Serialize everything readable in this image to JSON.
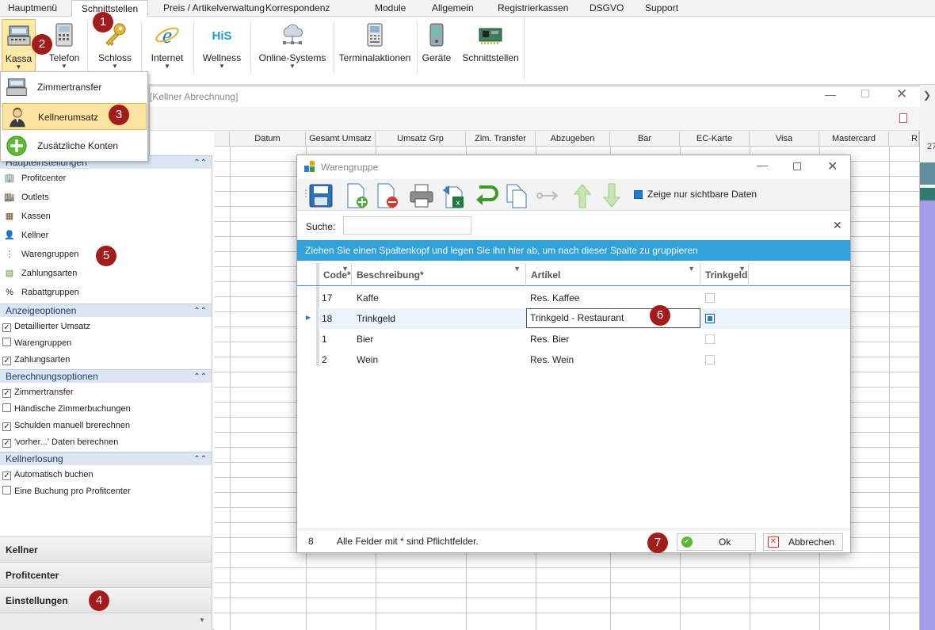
{
  "menu": {
    "tabs": [
      "Hauptmenü",
      "Schnittstellen",
      "Preis / Artikelverwaltung",
      "Korrespondenz",
      "Module",
      "Allgemein",
      "Registrierkassen",
      "DSGVO",
      "Support"
    ]
  },
  "ribbon": {
    "buttons": [
      {
        "label": "Kassa",
        "icon": "cash-register-icon"
      },
      {
        "label": "Telefon",
        "icon": "phone-icon"
      },
      {
        "label": "Schloss",
        "icon": "key-icon"
      },
      {
        "label": "Internet",
        "icon": "internet-explorer-icon"
      },
      {
        "label": "Wellness",
        "icon": "his-logo-icon"
      },
      {
        "label": "Online-Systems",
        "icon": "cloud-network-icon"
      },
      {
        "label": "Terminalaktionen",
        "icon": "terminal-icon"
      },
      {
        "label": "Geräte",
        "icon": "device-icon"
      },
      {
        "label": "Schnittstellen",
        "icon": "circuit-board-icon"
      }
    ]
  },
  "dropdown": {
    "items": [
      {
        "label": "Zimmertransfer",
        "icon": "cash-register-icon"
      },
      {
        "label": "Kellnerumsatz",
        "icon": "waiter-icon"
      },
      {
        "label": "Zusätzliche Konten",
        "icon": "add-icon"
      }
    ]
  },
  "backwindow": {
    "title": "[Kellner Abrechnung]",
    "columns": [
      "Datum",
      "Gesamt Umsatz",
      "Umsatz Grp",
      "Zim. Transfer",
      "Abzugeben",
      "Bar",
      "EC-Karte",
      "Visa",
      "Mastercard",
      "R"
    ],
    "right_edge_value": "27"
  },
  "leftpanel": {
    "groups": {
      "haupt": "Haupteinstellungen",
      "anzeige": "Anzeigeoptionen",
      "berechnung": "Berechnungsoptionen",
      "kellnerlosung": "Kellnerlosung"
    },
    "haupt_items": [
      "Profitcenter",
      "Outlets",
      "Kassen",
      "Kellner",
      "Warengruppen",
      "Zahlungsarten",
      "Rabattgruppen"
    ],
    "anzeige_items": [
      {
        "label": "Detaillierter Umsatz",
        "checked": true
      },
      {
        "label": "Warengruppen",
        "checked": false
      },
      {
        "label": "Zahlungsarten",
        "checked": true
      }
    ],
    "berechnung_items": [
      {
        "label": "Zimmertransfer",
        "checked": true
      },
      {
        "label": "Händische Zimmerbuchungen",
        "checked": false
      },
      {
        "label": "Schulden manuell brerechnen",
        "checked": true
      },
      {
        "label": "'vorher...' Daten berechnen",
        "checked": true
      }
    ],
    "kellner_items": [
      {
        "label": "Automatisch buchen",
        "checked": true
      },
      {
        "label": "Eine Buchung pro Profitcenter",
        "checked": false
      }
    ],
    "nav": [
      "Kellner",
      "Profitcenter",
      "Einstellungen"
    ]
  },
  "dialog": {
    "title": "Warengruppe",
    "visible_only_label": "Zeige nur sichtbare Daten",
    "search_label": "Suche:",
    "search_value": "",
    "group_hint": "Ziehen Sie einen Spaltenkopf und legen Sie ihn hier ab, um nach dieser Spalte zu gruppieren",
    "columns": [
      "Code*",
      "Beschreibung*",
      "Artikel",
      "Trinkgeld"
    ],
    "rows": [
      {
        "code": "17",
        "beschreibung": "Kaffe",
        "artikel": "Res. Kaffee",
        "trinkgeld": false
      },
      {
        "code": "18",
        "beschreibung": "Trinkgeld",
        "artikel": "Trinkgeld - Restaurant",
        "trinkgeld": true
      },
      {
        "code": "1",
        "beschreibung": "Bier",
        "artikel": "Res. Bier",
        "trinkgeld": false
      },
      {
        "code": "2",
        "beschreibung": "Wein",
        "artikel": "Res. Wein",
        "trinkgeld": false
      }
    ],
    "footer_count": "8",
    "footer_note": "Alle Felder mit * sind Pflichtfelder.",
    "ok_label": "Ok",
    "cancel_label": "Abbrechen"
  },
  "badges": [
    "1",
    "2",
    "3",
    "4",
    "5",
    "6",
    "7"
  ],
  "colors": {
    "accent": "#2ea2d9",
    "badge": "#a31c1c",
    "selected": "#fbe3a1"
  }
}
